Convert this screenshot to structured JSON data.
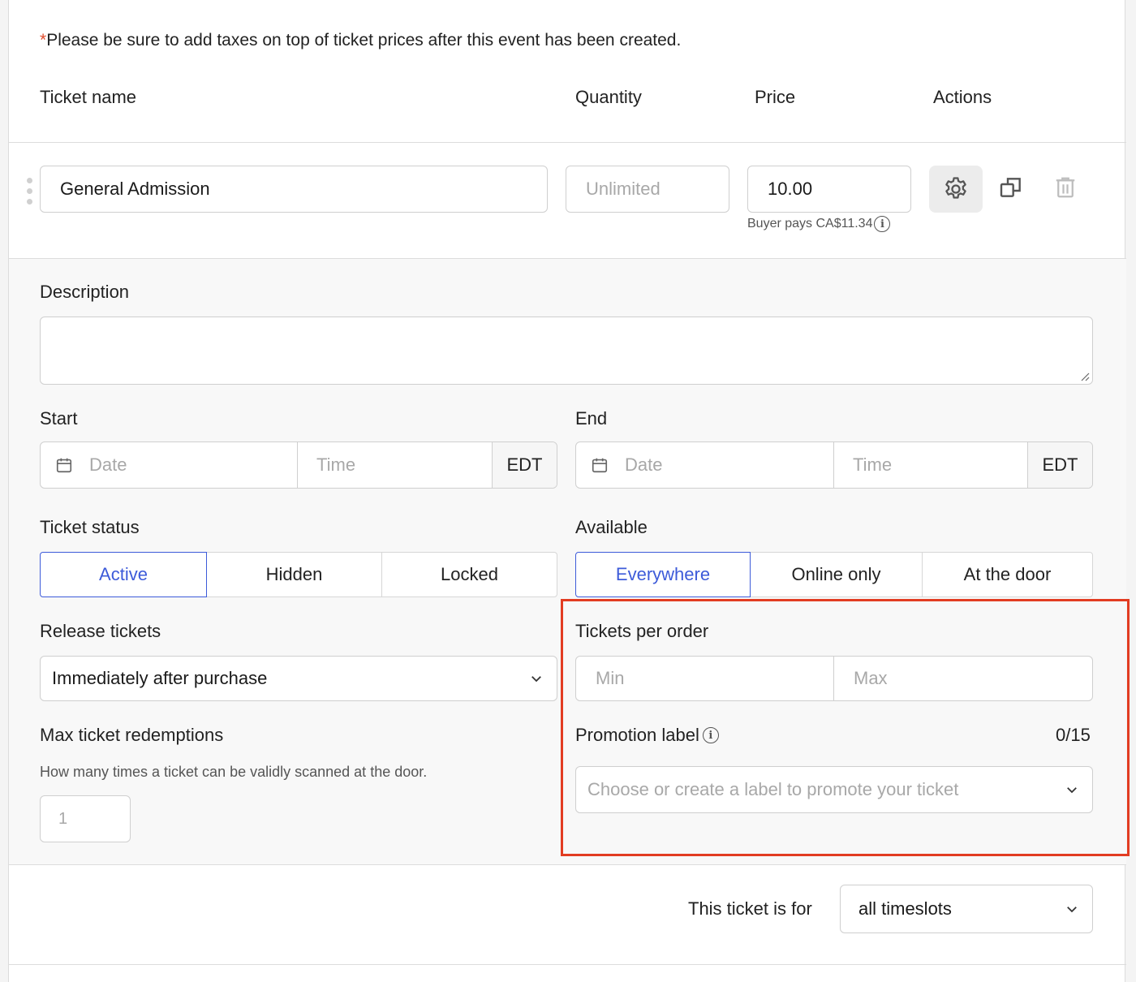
{
  "notice": {
    "asterisk": "*",
    "text": "Please be sure to add taxes on top of ticket prices after this event has been created."
  },
  "columns": {
    "ticket_name": "Ticket name",
    "quantity": "Quantity",
    "price": "Price",
    "actions": "Actions"
  },
  "ticket": {
    "name": "General Admission",
    "quantity_placeholder": "Unlimited",
    "price": "10.00",
    "buyer_pays": "Buyer pays CA$11.34"
  },
  "details": {
    "description_label": "Description",
    "start_label": "Start",
    "end_label": "End",
    "date_placeholder": "Date",
    "time_placeholder": "Time",
    "timezone": "EDT",
    "ticket_status_label": "Ticket status",
    "ticket_status_options": [
      "Active",
      "Hidden",
      "Locked"
    ],
    "available_label": "Available",
    "available_options": [
      "Everywhere",
      "Online only",
      "At the door"
    ],
    "release_label": "Release tickets",
    "release_value": "Immediately after purchase",
    "tickets_per_order_label": "Tickets per order",
    "min_placeholder": "Min",
    "max_placeholder": "Max",
    "max_redemptions_label": "Max ticket redemptions",
    "max_redemptions_hint": "How many times a ticket can be validly scanned at the door.",
    "max_redemptions_placeholder": "1",
    "promotion_label": "Promotion label",
    "promotion_counter": "0/15",
    "promotion_placeholder": "Choose or create a label to promote your ticket"
  },
  "footer": {
    "ticket_for_label": "This ticket is for",
    "ticket_for_value": "all timeslots"
  },
  "colors": {
    "accent": "#3d5bd9",
    "highlight": "#e23c22",
    "asterisk": "#e04b2c"
  }
}
